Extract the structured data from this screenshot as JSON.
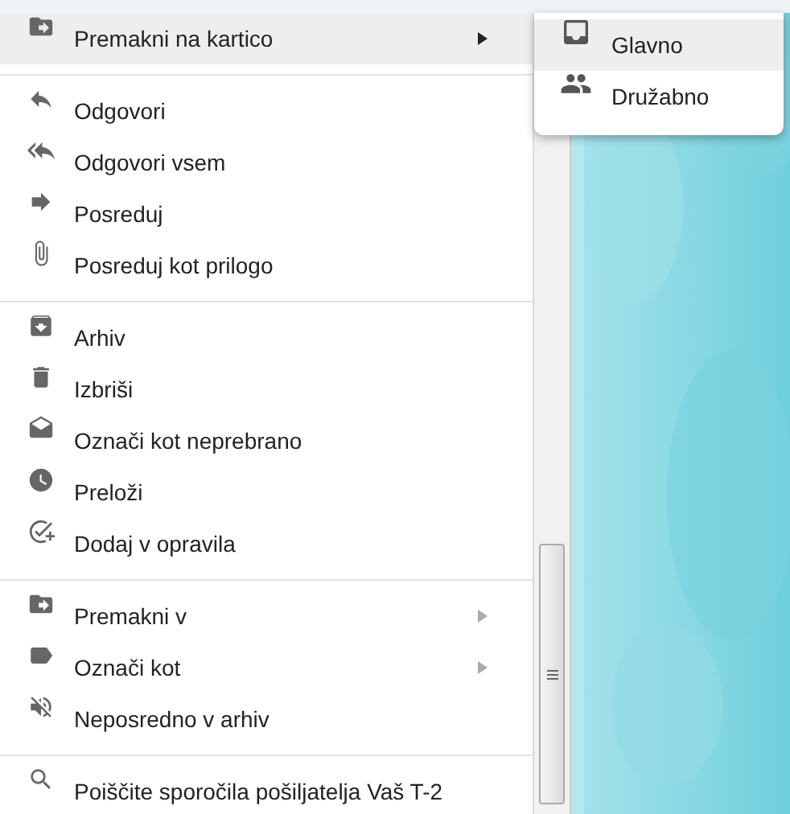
{
  "menu": {
    "groups": [
      {
        "items": [
          {
            "label": "Premakni na kartico",
            "submenu": true,
            "selected": true
          }
        ]
      },
      {
        "items": [
          {
            "label": "Odgovori",
            "submenu": false,
            "selected": false
          },
          {
            "label": "Odgovori vsem",
            "submenu": false,
            "selected": false
          },
          {
            "label": "Posreduj",
            "submenu": false,
            "selected": false
          },
          {
            "label": "Posreduj kot prilogo",
            "submenu": false,
            "selected": false
          }
        ]
      },
      {
        "items": [
          {
            "label": "Arhiv",
            "submenu": false,
            "selected": false
          },
          {
            "label": "Izbriši",
            "submenu": false,
            "selected": false
          },
          {
            "label": "Označi kot neprebrano",
            "submenu": false,
            "selected": false
          },
          {
            "label": "Preloži",
            "submenu": false,
            "selected": false
          },
          {
            "label": "Dodaj v opravila",
            "submenu": false,
            "selected": false
          }
        ]
      },
      {
        "items": [
          {
            "label": "Premakni v",
            "submenu": true,
            "selected": false
          },
          {
            "label": "Označi kot",
            "submenu": true,
            "selected": false
          },
          {
            "label": "Neposredno v arhiv",
            "submenu": false,
            "selected": false
          }
        ]
      },
      {
        "items": [
          {
            "label": "Poiščite sporočila pošiljatelja Vaš T-2",
            "submenu": false,
            "selected": false
          }
        ]
      }
    ]
  },
  "submenu": {
    "items": [
      {
        "label": "Glavno",
        "selected": true
      },
      {
        "label": "Družabno",
        "selected": false
      }
    ]
  }
}
